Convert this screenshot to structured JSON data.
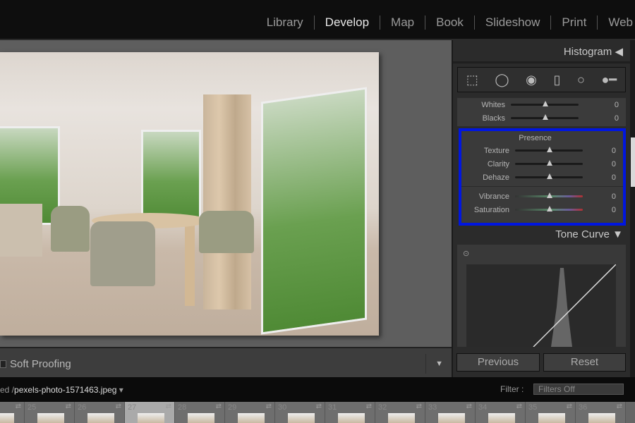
{
  "modules": [
    "Library",
    "Develop",
    "Map",
    "Book",
    "Slideshow",
    "Print",
    "Web"
  ],
  "active_module": "Develop",
  "toolbar": {
    "soft_proofing": "Soft Proofing"
  },
  "panel": {
    "histogram": "Histogram",
    "tools": [
      "crop-overlay",
      "spot-removal",
      "red-eye",
      "graduated-filter",
      "radial-filter",
      "adjustment-brush"
    ],
    "tone_rows": [
      {
        "label": "Whites",
        "value": "0"
      },
      {
        "label": "Blacks",
        "value": "0"
      }
    ],
    "presence": {
      "title": "Presence",
      "rows": [
        {
          "label": "Texture",
          "value": "0"
        },
        {
          "label": "Clarity",
          "value": "0"
        },
        {
          "label": "Dehaze",
          "value": "0"
        },
        {
          "label": "Vibrance",
          "value": "0"
        },
        {
          "label": "Saturation",
          "value": "0"
        }
      ]
    },
    "tone_curve": "Tone Curve",
    "previous": "Previous",
    "reset": "Reset"
  },
  "filmstrip": {
    "path_prefix": "ed /",
    "filename": "pexels-photo-1571463.jpeg",
    "filter_label": "Filter :",
    "filter_value": "Filters Off",
    "numbers": [
      "24",
      "25",
      "26",
      "27",
      "28",
      "29",
      "30",
      "31",
      "32",
      "33",
      "34",
      "35",
      "36"
    ],
    "selected": "27"
  },
  "colors": {
    "highlight": "#0016e0"
  }
}
